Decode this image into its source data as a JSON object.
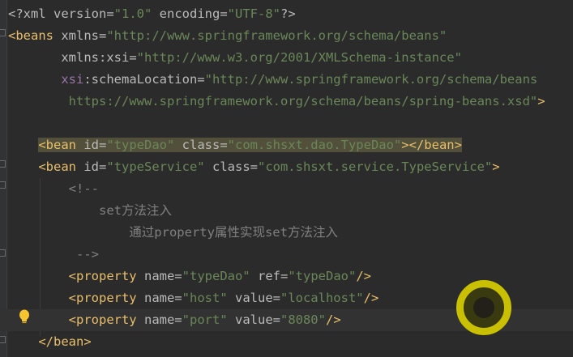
{
  "colors": {
    "background": "#2b2b2b",
    "tag": "#e8bf6a",
    "attr": "#bababa",
    "value": "#6a8759",
    "text": "#a9b7c6",
    "comment": "#808080",
    "xmlns_attr": "#9876aa"
  },
  "lines": [
    [
      {
        "t": "<?xml version=",
        "c": "attr"
      },
      {
        "t": "\"1.0\"",
        "c": "value"
      },
      {
        "t": " encoding=",
        "c": "attr"
      },
      {
        "t": "\"UTF-8\"",
        "c": "value"
      },
      {
        "t": "?>",
        "c": "attr"
      }
    ],
    [
      {
        "t": "<beans ",
        "c": "tag"
      },
      {
        "t": "xmlns=",
        "c": "attr"
      },
      {
        "t": "\"http://www.springframework.org/schema/beans\"",
        "c": "value"
      }
    ],
    [
      {
        "t": "       ",
        "c": "text"
      },
      {
        "t": "xmlns:xsi=",
        "c": "attr"
      },
      {
        "t": "\"http://www.w3.org/2001/XMLSchema-instance\"",
        "c": "value"
      }
    ],
    [
      {
        "t": "       ",
        "c": "text"
      },
      {
        "t": "xsi",
        "c": "xmlns_attr"
      },
      {
        "t": ":schemaLocation=",
        "c": "attr"
      },
      {
        "t": "\"http://www.springframework.org/schema/beans",
        "c": "value"
      }
    ],
    [
      {
        "t": "        ",
        "c": "text"
      },
      {
        "t": "https://www.springframework.org/schema/beans/spring-beans.xsd\"",
        "c": "value"
      },
      {
        "t": ">",
        "c": "tag"
      }
    ],
    [],
    [
      {
        "t": "    ",
        "c": "text"
      },
      {
        "t": "<bean ",
        "c": "tag"
      },
      {
        "t": "id=",
        "c": "attr"
      },
      {
        "t": "\"typeDao\"",
        "c": "value"
      },
      {
        "t": " class=",
        "c": "attr"
      },
      {
        "t": "\"com.shsxt.dao.TypeDao\"",
        "c": "value"
      },
      {
        "t": "></bean>",
        "c": "tag"
      }
    ],
    [
      {
        "t": "    ",
        "c": "text"
      },
      {
        "t": "<bean ",
        "c": "tag"
      },
      {
        "t": "id=",
        "c": "attr"
      },
      {
        "t": "\"typeService\"",
        "c": "value"
      },
      {
        "t": " class=",
        "c": "attr"
      },
      {
        "t": "\"com.shsxt.service.TypeService\"",
        "c": "value"
      },
      {
        "t": ">",
        "c": "tag"
      }
    ],
    [
      {
        "t": "        <!--",
        "c": "comment"
      }
    ],
    [
      {
        "t": "            set方法注入",
        "c": "comment"
      }
    ],
    [
      {
        "t": "                通过property属性实现set方法注入",
        "c": "comment"
      }
    ],
    [
      {
        "t": "         -->",
        "c": "comment"
      }
    ],
    [
      {
        "t": "        ",
        "c": "text"
      },
      {
        "t": "<property ",
        "c": "tag"
      },
      {
        "t": "name=",
        "c": "attr"
      },
      {
        "t": "\"typeDao\"",
        "c": "value"
      },
      {
        "t": " ref=",
        "c": "attr"
      },
      {
        "t": "\"typeDao\"",
        "c": "value"
      },
      {
        "t": "/>",
        "c": "tag"
      }
    ],
    [
      {
        "t": "        ",
        "c": "text"
      },
      {
        "t": "<property ",
        "c": "tag"
      },
      {
        "t": "name=",
        "c": "attr"
      },
      {
        "t": "\"host\"",
        "c": "value"
      },
      {
        "t": " value=",
        "c": "attr"
      },
      {
        "t": "\"localhost\"",
        "c": "value"
      },
      {
        "t": "/>",
        "c": "tag"
      }
    ],
    [
      {
        "t": "        ",
        "c": "text"
      },
      {
        "t": "<property ",
        "c": "tag"
      },
      {
        "t": "name=",
        "c": "attr"
      },
      {
        "t": "\"port\"",
        "c": "value"
      },
      {
        "t": " value=",
        "c": "attr"
      },
      {
        "t": "\"8080\"",
        "c": "value"
      },
      {
        "t": "/>",
        "c": "tag"
      }
    ],
    [
      {
        "t": "    ",
        "c": "text"
      },
      {
        "t": "</bean>",
        "c": "tag"
      }
    ]
  ],
  "highlight_line": 6,
  "caret_line": 14,
  "intention_icon": "lightbulb-icon",
  "cursor_indicator": "click-cursor-icon"
}
